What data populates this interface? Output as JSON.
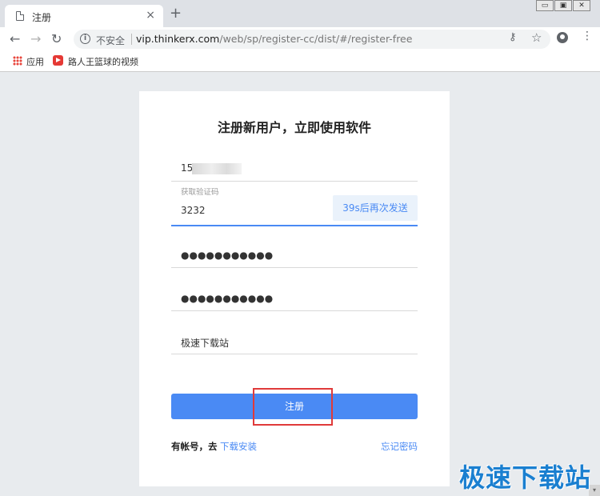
{
  "browser": {
    "tab_title": "注册",
    "tab_close": "×",
    "new_tab": "+",
    "security_label": "不安全",
    "url_host": "vip.thinkerx.com",
    "url_path": "/web/sp/register-cc/dist/#/register-free",
    "bookmarks": [
      {
        "label": "应用",
        "icon": "apps-grid-icon"
      },
      {
        "label": "路人王篮球的视频",
        "icon": "video-icon"
      }
    ]
  },
  "form": {
    "title": "注册新用户，立即使用软件",
    "phone_value": "15",
    "code_label": "获取验证码",
    "code_value": "3232",
    "resend_label": "39s后再次发送",
    "password_value": "●●●●●●●●●●●",
    "confirm_value": "●●●●●●●●●●●",
    "invite_value": "极速下载站",
    "submit_label": "注册",
    "has_account_text": "有帐号，去",
    "download_link": "下载安装",
    "forgot_link": "忘记密码"
  },
  "watermark": "极速下载站",
  "colors": {
    "accent": "#4a8af4",
    "highlight": "#e03a3a"
  }
}
